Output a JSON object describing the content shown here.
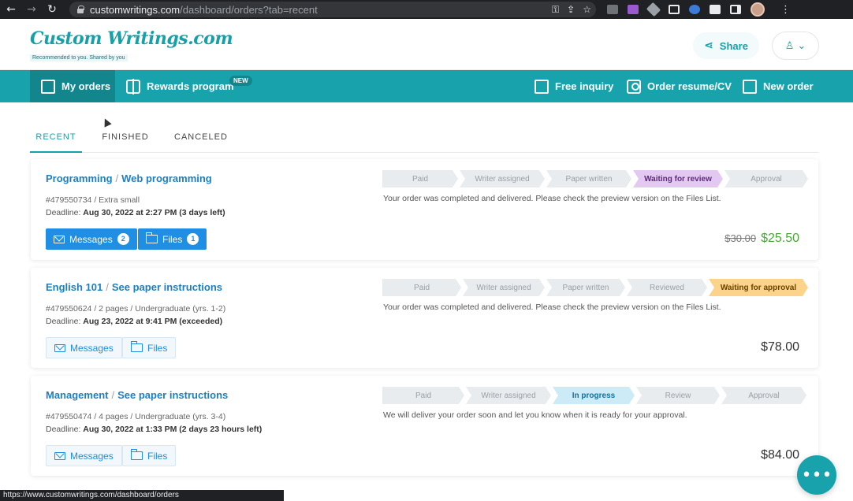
{
  "browser": {
    "url_host": "customwritings.com",
    "url_path": "/dashboard/orders?tab=recent"
  },
  "header": {
    "logo_text": "Custom Writings.com",
    "logo_tagline": "Recommended to you. Shared by you",
    "share_label": "Share"
  },
  "nav": {
    "my_orders": "My orders",
    "rewards": "Rewards program",
    "new_badge": "NEW",
    "free_inquiry": "Free inquiry",
    "order_resume": "Order resume/CV",
    "new_order": "New order"
  },
  "tabs": [
    "RECENT",
    "FINISHED",
    "CANCELED"
  ],
  "orders": [
    {
      "subject": "Programming",
      "topic": "Web programming",
      "meta": "#479550734 / Extra small",
      "deadline_label": "Deadline:",
      "deadline": "Aug 30, 2022 at 2:27 PM (3 days left)",
      "messages_label": "Messages",
      "messages_count": "2",
      "files_label": "Files",
      "files_count": "1",
      "steps": [
        "Paid",
        "Writer assigned",
        "Paper written",
        "Waiting for review",
        "Approval"
      ],
      "status_message": "Your order was completed and delivered. Please check the preview version on the Files List.",
      "price_old": "$30.00",
      "price": "$25.50"
    },
    {
      "subject": "English 101",
      "topic": "See paper instructions",
      "meta": "#479550624 / 2 pages / Undergraduate (yrs. 1-2)",
      "deadline_label": "Deadline:",
      "deadline": "Aug 23, 2022 at 9:41 PM (exceeded)",
      "messages_label": "Messages",
      "files_label": "Files",
      "steps": [
        "Paid",
        "Writer assigned",
        "Paper written",
        "Reviewed",
        "Waiting for approval"
      ],
      "status_message": "Your order was completed and delivered. Please check the preview version on the Files List.",
      "price": "$78.00"
    },
    {
      "subject": "Management",
      "topic": "See paper instructions",
      "meta": "#479550474 / 4 pages / Undergraduate (yrs. 3-4)",
      "deadline_label": "Deadline:",
      "deadline": "Aug 30, 2022 at 1:33 PM (2 days 23 hours left)",
      "messages_label": "Messages",
      "files_label": "Files",
      "steps": [
        "Paid",
        "Writer assigned",
        "In progress",
        "Review",
        "Approval"
      ],
      "status_message": "We will deliver your order soon and let you know when it is ready for your approval.",
      "price": "$84.00"
    }
  ],
  "status_bar": "https://www.customwritings.com/dashboard/orders",
  "colors": {
    "teal": "#17a2ac",
    "link_blue": "#1e7fbf",
    "button_blue": "#1f8ee3",
    "discount_green": "#4aa43a",
    "step_purple": "#e3c9f2",
    "step_orange": "#fcd38b",
    "step_blue": "#cdeaf7"
  }
}
